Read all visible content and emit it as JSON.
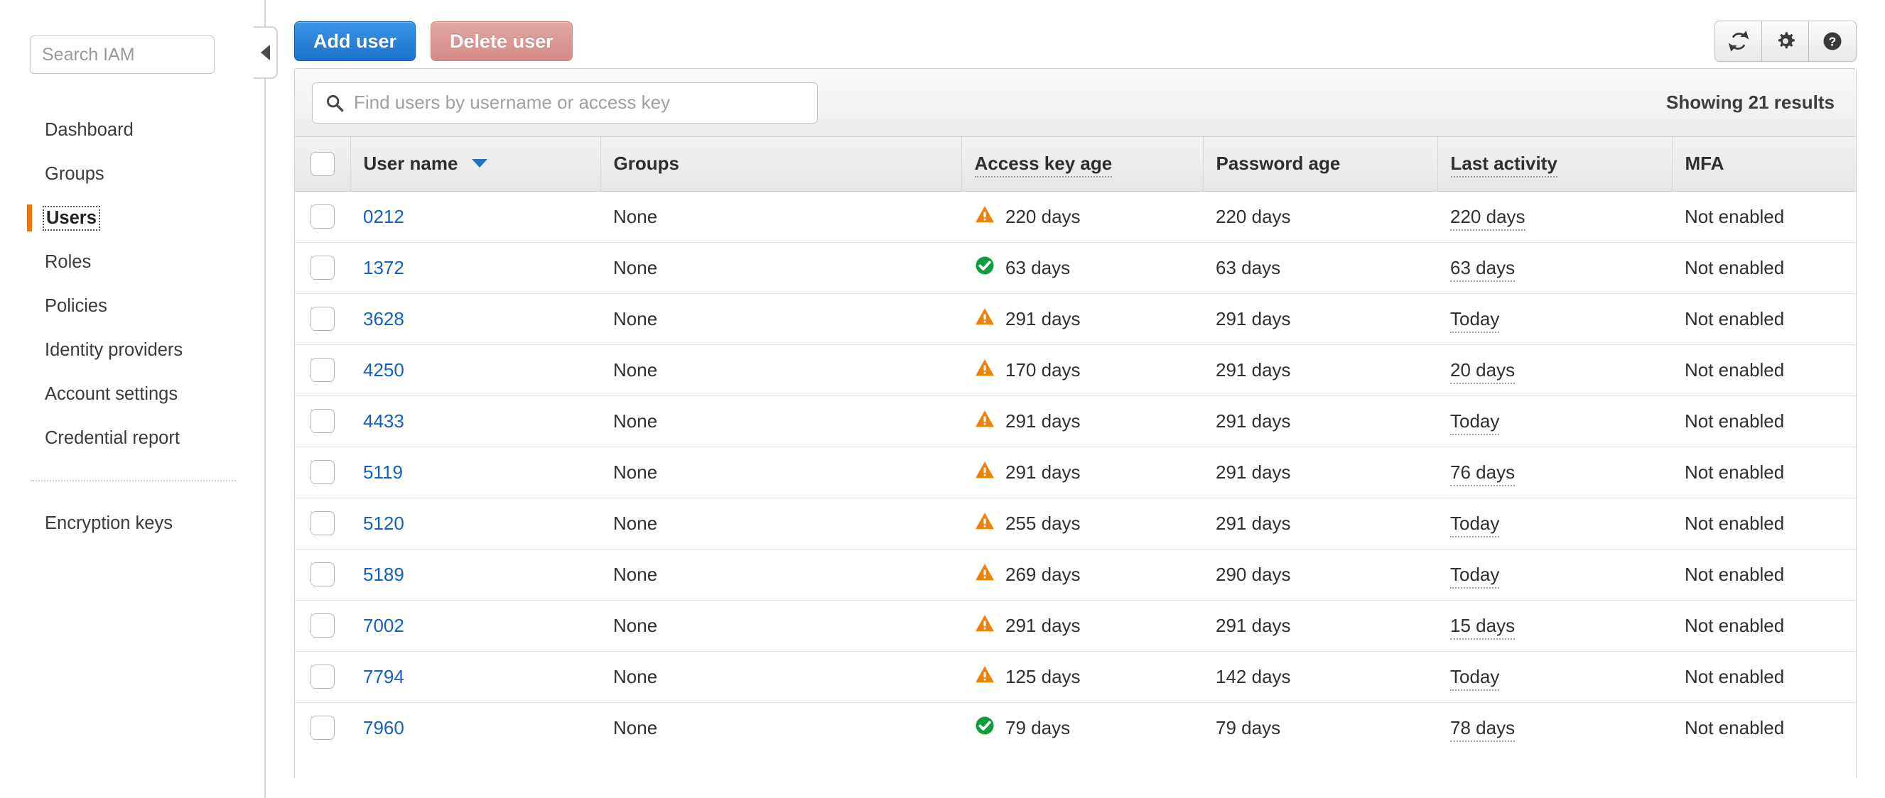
{
  "sidebar": {
    "search": {
      "placeholder": "Search IAM",
      "value": ""
    },
    "items": [
      {
        "label": "Dashboard"
      },
      {
        "label": "Groups"
      },
      {
        "label": "Users"
      },
      {
        "label": "Roles"
      },
      {
        "label": "Policies"
      },
      {
        "label": "Identity providers"
      },
      {
        "label": "Account settings"
      },
      {
        "label": "Credential report"
      }
    ],
    "items_after_divider": [
      {
        "label": "Encryption keys"
      }
    ],
    "collapse_icon": "chevron-left-icon"
  },
  "toolbar": {
    "add_user_label": "Add user",
    "delete_user_label": "Delete user",
    "refresh_icon": "refresh-icon",
    "settings_icon": "gear-icon",
    "help_icon": "help-icon"
  },
  "panel": {
    "search": {
      "placeholder": "Find users by username or access key",
      "value": ""
    },
    "search_icon": "search-icon",
    "results_text": "Showing 21 results"
  },
  "table": {
    "columns": [
      {
        "label": "User name",
        "sort": "desc",
        "hint": false
      },
      {
        "label": "Groups",
        "hint": false
      },
      {
        "label": "Access key age",
        "hint": true
      },
      {
        "label": "Password age",
        "hint": false
      },
      {
        "label": "Last activity",
        "hint": true
      },
      {
        "label": "MFA",
        "hint": false
      }
    ],
    "rows": [
      {
        "user": "0212",
        "groups": "None",
        "key_status": "warning",
        "key_age": "220 days",
        "password_age": "220 days",
        "last_activity": "220 days",
        "mfa": "Not enabled"
      },
      {
        "user": "1372",
        "groups": "None",
        "key_status": "ok",
        "key_age": "63 days",
        "password_age": "63 days",
        "last_activity": "63 days",
        "mfa": "Not enabled"
      },
      {
        "user": "3628",
        "groups": "None",
        "key_status": "warning",
        "key_age": "291 days",
        "password_age": "291 days",
        "last_activity": "Today",
        "mfa": "Not enabled"
      },
      {
        "user": "4250",
        "groups": "None",
        "key_status": "warning",
        "key_age": "170 days",
        "password_age": "291 days",
        "last_activity": "20 days",
        "mfa": "Not enabled"
      },
      {
        "user": "4433",
        "groups": "None",
        "key_status": "warning",
        "key_age": "291 days",
        "password_age": "291 days",
        "last_activity": "Today",
        "mfa": "Not enabled"
      },
      {
        "user": "5119",
        "groups": "None",
        "key_status": "warning",
        "key_age": "291 days",
        "password_age": "291 days",
        "last_activity": "76 days",
        "mfa": "Not enabled"
      },
      {
        "user": "5120",
        "groups": "None",
        "key_status": "warning",
        "key_age": "255 days",
        "password_age": "291 days",
        "last_activity": "Today",
        "mfa": "Not enabled"
      },
      {
        "user": "5189",
        "groups": "None",
        "key_status": "warning",
        "key_age": "269 days",
        "password_age": "290 days",
        "last_activity": "Today",
        "mfa": "Not enabled"
      },
      {
        "user": "7002",
        "groups": "None",
        "key_status": "warning",
        "key_age": "291 days",
        "password_age": "291 days",
        "last_activity": "15 days",
        "mfa": "Not enabled"
      },
      {
        "user": "7794",
        "groups": "None",
        "key_status": "warning",
        "key_age": "125 days",
        "password_age": "142 days",
        "last_activity": "Today",
        "mfa": "Not enabled"
      },
      {
        "user": "7960",
        "groups": "None",
        "key_status": "ok",
        "key_age": "79 days",
        "password_age": "79 days",
        "last_activity": "78 days",
        "mfa": "Not enabled"
      }
    ]
  },
  "colors": {
    "accent_orange": "#e8780c",
    "link_blue": "#1160c4",
    "button_blue": "#1a72cb",
    "button_red": "#d58b89",
    "warning": "#e8840c",
    "success": "#0e9d3c"
  }
}
